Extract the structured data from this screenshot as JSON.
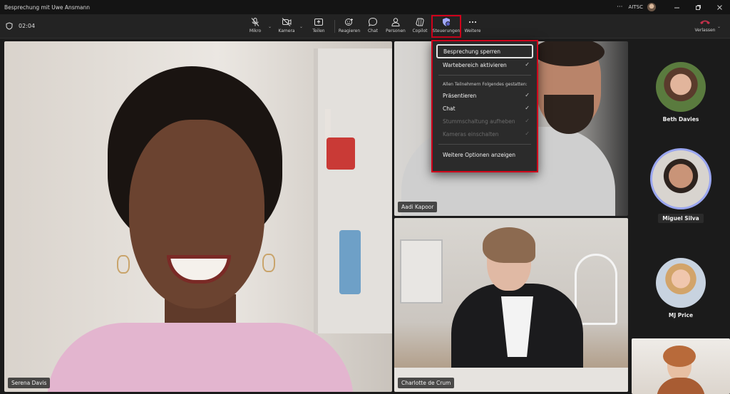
{
  "window": {
    "title": "Besprechung mit Uwe Ansmann",
    "more_glyph": "···",
    "org": "AITSC",
    "controls": [
      "minimize-icon",
      "restore-icon",
      "close-icon"
    ]
  },
  "toolbar": {
    "timer": "02:04",
    "items": [
      {
        "label": "Mikro",
        "icon": "mic-off-icon"
      },
      {
        "label": "Kamera",
        "icon": "camera-off-icon"
      },
      {
        "label": "Teilen",
        "icon": "share-icon"
      },
      {
        "label": "Reagieren",
        "icon": "react-icon"
      },
      {
        "label": "Chat",
        "icon": "chat-icon"
      },
      {
        "label": "Personen",
        "icon": "people-icon"
      },
      {
        "label": "Copilot",
        "icon": "copilot-icon"
      },
      {
        "label": "Steuerungen",
        "icon": "controls-shield-icon",
        "active": true
      },
      {
        "label": "Weitere",
        "icon": "more-icon"
      }
    ],
    "leave_label": "Verlassen",
    "colors": {
      "highlight": "#d0021b",
      "leave": "#c4314b"
    }
  },
  "menu": {
    "items": [
      {
        "label": "Besprechung sperren",
        "checked": false,
        "disabled": false,
        "focused": true
      },
      {
        "label": "Wartebereich aktivieren",
        "checked": true,
        "disabled": false
      }
    ],
    "section_header": "Allen Teilnehmern Folgendes gestatten:",
    "permissions": [
      {
        "label": "Präsentieren",
        "checked": true,
        "disabled": false
      },
      {
        "label": "Chat",
        "checked": true,
        "disabled": false
      },
      {
        "label": "Stummschaltung aufheben",
        "checked": true,
        "disabled": true
      },
      {
        "label": "Kameras einschalten",
        "checked": true,
        "disabled": true
      }
    ],
    "more_options": "Weitere Optionen anzeigen",
    "check_glyph": "✓"
  },
  "participants": {
    "video": [
      {
        "name": "Serena Davis"
      },
      {
        "name": "Aadi Kapoor"
      },
      {
        "name": "Charlotte de Crum"
      }
    ],
    "rail": [
      {
        "name": "Beth Davies",
        "speaking": false
      },
      {
        "name": "Miguel Silva",
        "speaking": true
      },
      {
        "name": "MJ Price",
        "speaking": false
      }
    ]
  }
}
